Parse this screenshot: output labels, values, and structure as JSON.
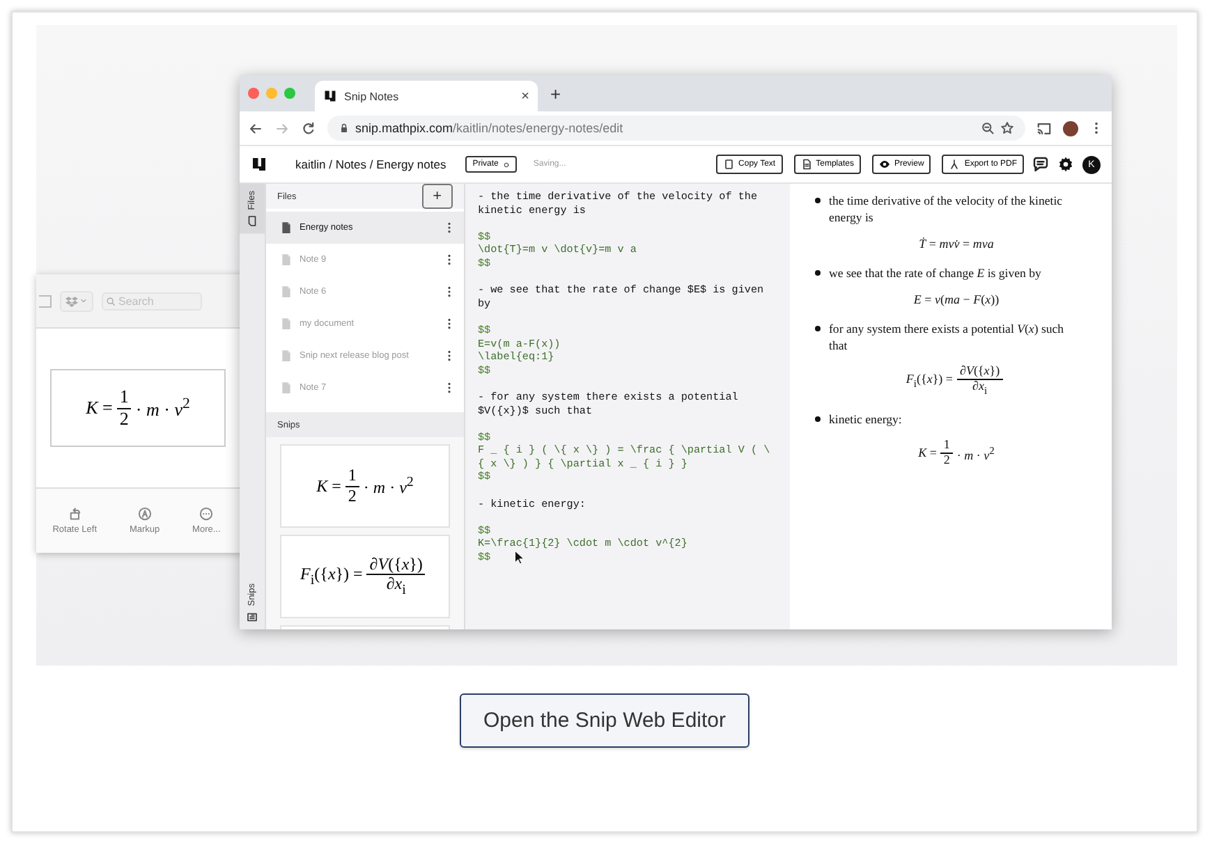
{
  "preview_window": {
    "search": {
      "placeholder": "Search"
    },
    "formula": {
      "kind": "fraction",
      "left": "*K* =",
      "num": "1",
      "den": "2",
      "right": "· *m* · *v*$^{2}$"
    },
    "tools": [
      {
        "label": "Rotate Left",
        "kind": "rotate"
      },
      {
        "label": "Markup",
        "kind": "markup"
      },
      {
        "label": "More...",
        "kind": "more"
      }
    ]
  },
  "browser": {
    "tabs": [
      {
        "title": "Snip Notes",
        "close": "×",
        "selected": true
      }
    ],
    "new_tab": "+",
    "url": {
      "host": "snip.mathpix.com",
      "path": "/kaitlin/notes/energy-notes/edit"
    }
  },
  "app": {
    "breadcrumb": "kaitlin / Notes / Energy notes",
    "visibility": "Private",
    "status": "Saving...",
    "actions": [
      {
        "label": "Copy Text",
        "kind": "copy"
      },
      {
        "label": "Templates",
        "kind": "doc"
      },
      {
        "label": "Preview",
        "kind": "eye"
      },
      {
        "label": "Export to PDF",
        "kind": "pdf"
      }
    ],
    "avatar": "K"
  },
  "side_tabs": [
    {
      "label": "Files",
      "kind": "filecard",
      "selected": true
    },
    {
      "label": "Snips",
      "kind": "snip",
      "selected": false
    }
  ],
  "files": {
    "title": "Files",
    "add": "+",
    "items": [
      {
        "name": "Energy notes",
        "selected": true
      },
      {
        "name": "Note 9",
        "selected": false
      },
      {
        "name": "Note 6",
        "selected": false
      },
      {
        "name": "my document",
        "selected": false
      },
      {
        "name": "Snip next release blog post",
        "selected": false
      },
      {
        "name": "Note 7",
        "selected": false
      }
    ]
  },
  "snips": {
    "title": "Snips",
    "cards": [
      {
        "kind": "fraction",
        "left": "*K* =",
        "num": "1",
        "den": "2",
        "right": "· *m* · *v*$^{2}$"
      },
      {
        "kind": "fraction",
        "left": "*F*$_{i}$({*x*}) =",
        "num": "∂*V*({*x*})",
        "den": "∂*x*$_{i}$"
      }
    ]
  },
  "editor": {
    "blocks": [
      {
        "kind": "prose",
        "text": "- the time derivative of the velocity of the kinetic energy is"
      },
      {
        "kind": "math",
        "lines": [
          "$$",
          "\\dot{T}=m v \\dot{v}=m v a",
          "$$"
        ]
      },
      {
        "kind": "prose",
        "text": "- we see that the rate of change $E$ is given by"
      },
      {
        "kind": "math",
        "lines": [
          "$$",
          "E=v(m a-F(x))",
          "\\label{eq:1}",
          "$$"
        ]
      },
      {
        "kind": "prose",
        "text": "- for any system there exists a potential $V({x})$ such that"
      },
      {
        "kind": "math",
        "lines": [
          "$$",
          "F _ { i } ( \\{ x \\} ) = \\frac { \\partial V ( \\{ x \\} ) } { \\partial x _ { i } }",
          "$$"
        ]
      },
      {
        "kind": "prose",
        "text": "- kinetic energy:"
      },
      {
        "kind": "math",
        "lines": [
          "$$",
          "K=\\frac{1}{2} \\cdot m \\cdot v^{2}",
          "$$"
        ]
      }
    ]
  },
  "preview": {
    "items": [
      {
        "text": "the time derivative of the velocity of the kinetic energy is",
        "formula": {
          "kind": "line",
          "text": "*Ṫ* = *mvv̇* = *mva*"
        }
      },
      {
        "text": "we see that the rate of change *E* is given by",
        "formula": {
          "kind": "line",
          "text": "*E* = *v*(*ma* − *F*(*x*))"
        }
      },
      {
        "text": "for any system there exists a potential *V*(*x*) such that",
        "formula": {
          "kind": "fraction",
          "left": "*F*$_{i}$({*x*}) =",
          "num": "∂*V*({*x*})",
          "den": "∂*x*$_{i}$"
        }
      },
      {
        "text": "kinetic energy:",
        "formula": {
          "kind": "fraction",
          "left": "*K* =",
          "num": "1",
          "den": "2",
          "right": "· *m* · *v*$^{2}$"
        }
      }
    ]
  },
  "cta": {
    "label": "Open the Snip Web Editor"
  }
}
